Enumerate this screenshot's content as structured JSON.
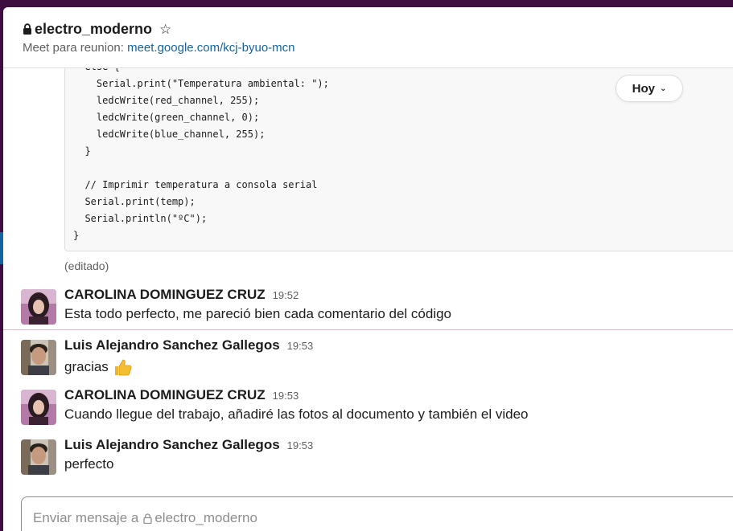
{
  "channel": {
    "name": "electro_moderno",
    "topic_prefix": "Meet para reunion: ",
    "topic_link": "meet.google.com/kcj-byuo-mcn"
  },
  "date_pill": {
    "label": "Hoy"
  },
  "code_block": {
    "text": "  else {\n    Serial.print(\"Temperatura ambiental: \");\n    ledcWrite(red_channel, 255);\n    ledcWrite(green_channel, 0);\n    ledcWrite(blue_channel, 255);\n  }\n\n  // Imprimir temperatura a consola serial\n  Serial.print(temp);\n  Serial.println(\"ºC\");\n}"
  },
  "edited_label": "(editado)",
  "messages": [
    {
      "sender": "CAROLINA DOMINGUEZ CRUZ",
      "time": "19:52",
      "text": "Esta todo perfecto,  me pareció bien cada comentario del código"
    },
    {
      "sender": "Luis Alejandro Sanchez Gallegos",
      "time": "19:53",
      "text": "gracias"
    },
    {
      "sender": "CAROLINA DOMINGUEZ CRUZ",
      "time": "19:53",
      "text": "Cuando llegue del trabajo, añadiré las fotos al documento y también el video"
    },
    {
      "sender": "Luis Alejandro Sanchez Gallegos",
      "time": "19:53",
      "text": "perfecto"
    }
  ],
  "composer": {
    "placeholder_prefix": "Enviar mensaje a",
    "placeholder_channel": "electro_moderno"
  },
  "icons": {
    "lock": "lock-icon",
    "star": "star-icon",
    "thumbs_up": "thumbs-up-icon",
    "chevron": "chevron-down-icon"
  },
  "colors": {
    "sidebar": "#3f0e40",
    "link": "#1264a3",
    "new_divider": "#d7bcd4"
  }
}
